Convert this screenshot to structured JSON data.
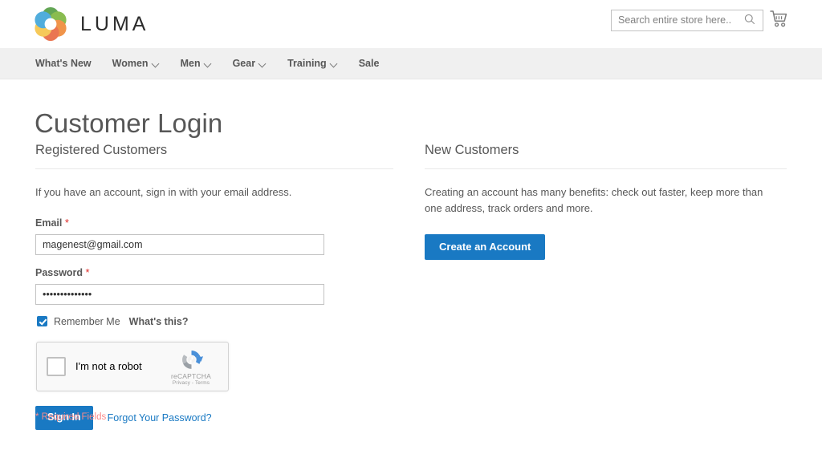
{
  "header": {
    "brand_name": "LUMA",
    "logo_colors": [
      "#3aa2d8",
      "#7fb63c",
      "#f6c445",
      "#ef8632",
      "#8d6040",
      "#4e8c3f"
    ],
    "search": {
      "placeholder": "Search entire store here...",
      "value": "",
      "icon": "search-icon"
    },
    "cart": {
      "icon": "shopping-cart-icon",
      "count": ""
    }
  },
  "nav": {
    "items": [
      {
        "label": "What's New",
        "has_dropdown": false
      },
      {
        "label": "Women",
        "has_dropdown": true
      },
      {
        "label": "Men",
        "has_dropdown": true
      },
      {
        "label": "Gear",
        "has_dropdown": true
      },
      {
        "label": "Training",
        "has_dropdown": true
      },
      {
        "label": "Sale",
        "has_dropdown": false
      }
    ]
  },
  "page": {
    "title": "Customer Login",
    "required_fields_note": "* Required Fields"
  },
  "login": {
    "heading": "Registered Customers",
    "intro": "If you have an account, sign in with your email address.",
    "email": {
      "label": "Email",
      "required_marker": "*",
      "value": "magenest@gmail.com",
      "placeholder": ""
    },
    "password": {
      "label": "Password",
      "required_marker": "*",
      "value": "••••••••••••••",
      "placeholder": ""
    },
    "remember": {
      "checked_label": "Remember Me",
      "help_label": "What's this?",
      "checked": "true"
    },
    "recaptcha": {
      "label": "I'm not a robot",
      "brand": "reCAPTCHA",
      "terms": "Privacy - Terms",
      "checked": "false"
    },
    "submit_label": "Sign In",
    "forgot_label": "Forgot Your Password?"
  },
  "new_customers": {
    "heading": "New Customers",
    "intro": "Creating an account has many benefits: check out faster, keep more than one address, track orders and more.",
    "create_label": "Create an Account"
  },
  "colors": {
    "accent": "#1979c3",
    "nav_bg": "#f0f0f0",
    "text": "#575757",
    "required": "#e02b27"
  }
}
